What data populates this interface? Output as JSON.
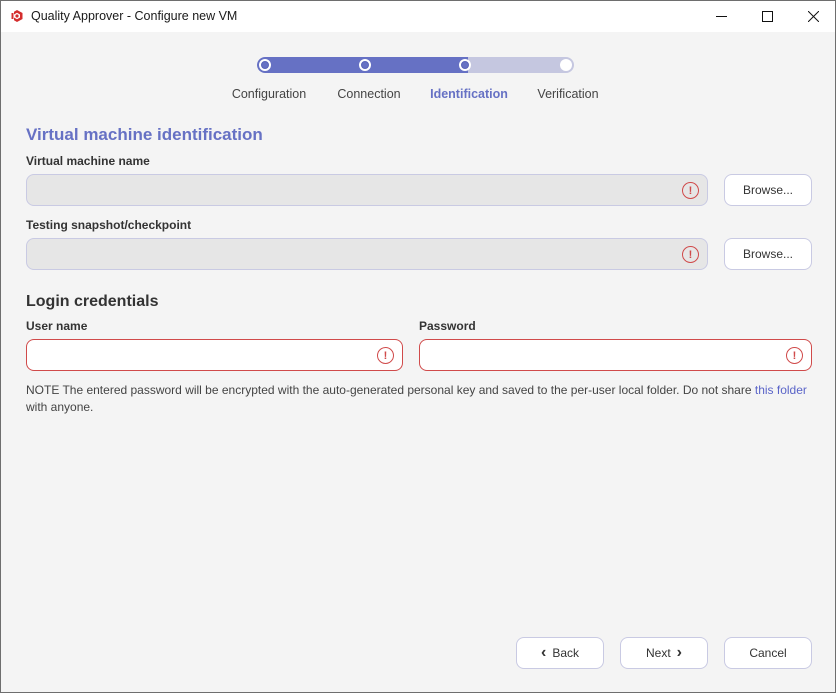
{
  "window": {
    "title": "Quality Approver - Configure new VM",
    "controls": {
      "minimize": "minimize",
      "maximize": "maximize",
      "close": "close"
    },
    "brand_color": "#d42d2d"
  },
  "stepper": {
    "steps": [
      {
        "label": "Configuration",
        "state": "done"
      },
      {
        "label": "Connection",
        "state": "done"
      },
      {
        "label": "Identification",
        "state": "current"
      },
      {
        "label": "Verification",
        "state": "pending"
      }
    ],
    "progress_fraction": 0.667,
    "accent_color": "#6671c4",
    "track_color": "#c5c7e0"
  },
  "vm_section": {
    "title": "Virtual machine identification",
    "vm_name": {
      "label": "Virtual machine name",
      "value": "",
      "placeholder": "",
      "error": true,
      "browse_label": "Browse..."
    },
    "snapshot": {
      "label": "Testing snapshot/checkpoint",
      "value": "",
      "placeholder": "",
      "error": true,
      "browse_label": "Browse..."
    }
  },
  "credentials": {
    "title": "Login credentials",
    "username": {
      "label": "User name",
      "value": "",
      "placeholder": "",
      "error": true
    },
    "password": {
      "label": "Password",
      "value": "",
      "placeholder": "",
      "error": true
    },
    "error_color": "#d04a4a"
  },
  "note": {
    "text_before": "NOTE The entered password will be encrypted with the auto-generated personal key and saved to the per-user local folder. Do not share ",
    "link_text": "this folder",
    "text_after": " with anyone."
  },
  "footer": {
    "back_label": "Back",
    "next_label": "Next",
    "cancel_label": "Cancel"
  },
  "icons": {
    "error": "!",
    "back": "‹",
    "next": "›"
  }
}
